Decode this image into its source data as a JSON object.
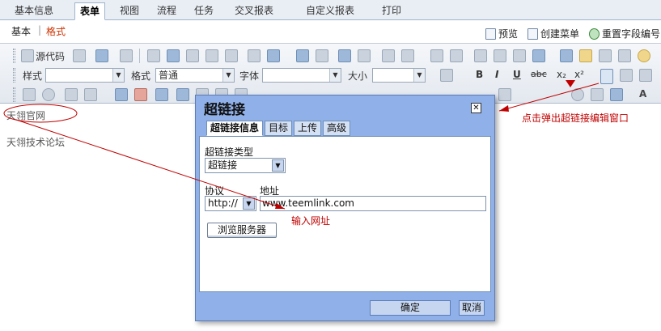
{
  "top_tabs": [
    {
      "label": "基本信息"
    },
    {
      "label": "表单",
      "active": true
    },
    {
      "label": "视图"
    },
    {
      "label": "流程"
    },
    {
      "label": "任务"
    },
    {
      "label": "交叉报表"
    },
    {
      "label": "自定义报表"
    },
    {
      "label": "打印"
    }
  ],
  "sub_tabs": {
    "basic": "基本",
    "separator": "|",
    "format": "格式",
    "active_color": "#cc3300"
  },
  "actions": {
    "preview": "预览",
    "create_menu": "创建菜单",
    "reset_field_numbers": "重置字段编号"
  },
  "toolbar": {
    "source_code": "源代码",
    "style_label": "样式",
    "format_label": "格式",
    "format_value": "普通",
    "font_label": "字体",
    "size_label": "大小",
    "bold": "B",
    "italic": "I",
    "underline": "U",
    "strike": "abc",
    "subscript": "x₂",
    "superscript": "x²",
    "text_color": "A"
  },
  "content": {
    "line1": "天翎官网",
    "line2": "天翎技术论坛"
  },
  "dialog": {
    "title": "超链接",
    "close": "✕",
    "tabs": [
      "超链接信息",
      "目标",
      "上传",
      "高级"
    ],
    "link_type_label": "超链接类型",
    "link_type_value": "超链接",
    "protocol_label": "协议",
    "protocol_value": "http://",
    "url_label": "地址",
    "url_value": "www.teemlink.com",
    "browse_button": "浏览服务器",
    "ok": "确定",
    "cancel": "取消"
  },
  "annotations": {
    "popup_hint": "点击弹出超链接编辑窗口",
    "input_hint": "输入网址",
    "color": "#c00000"
  }
}
